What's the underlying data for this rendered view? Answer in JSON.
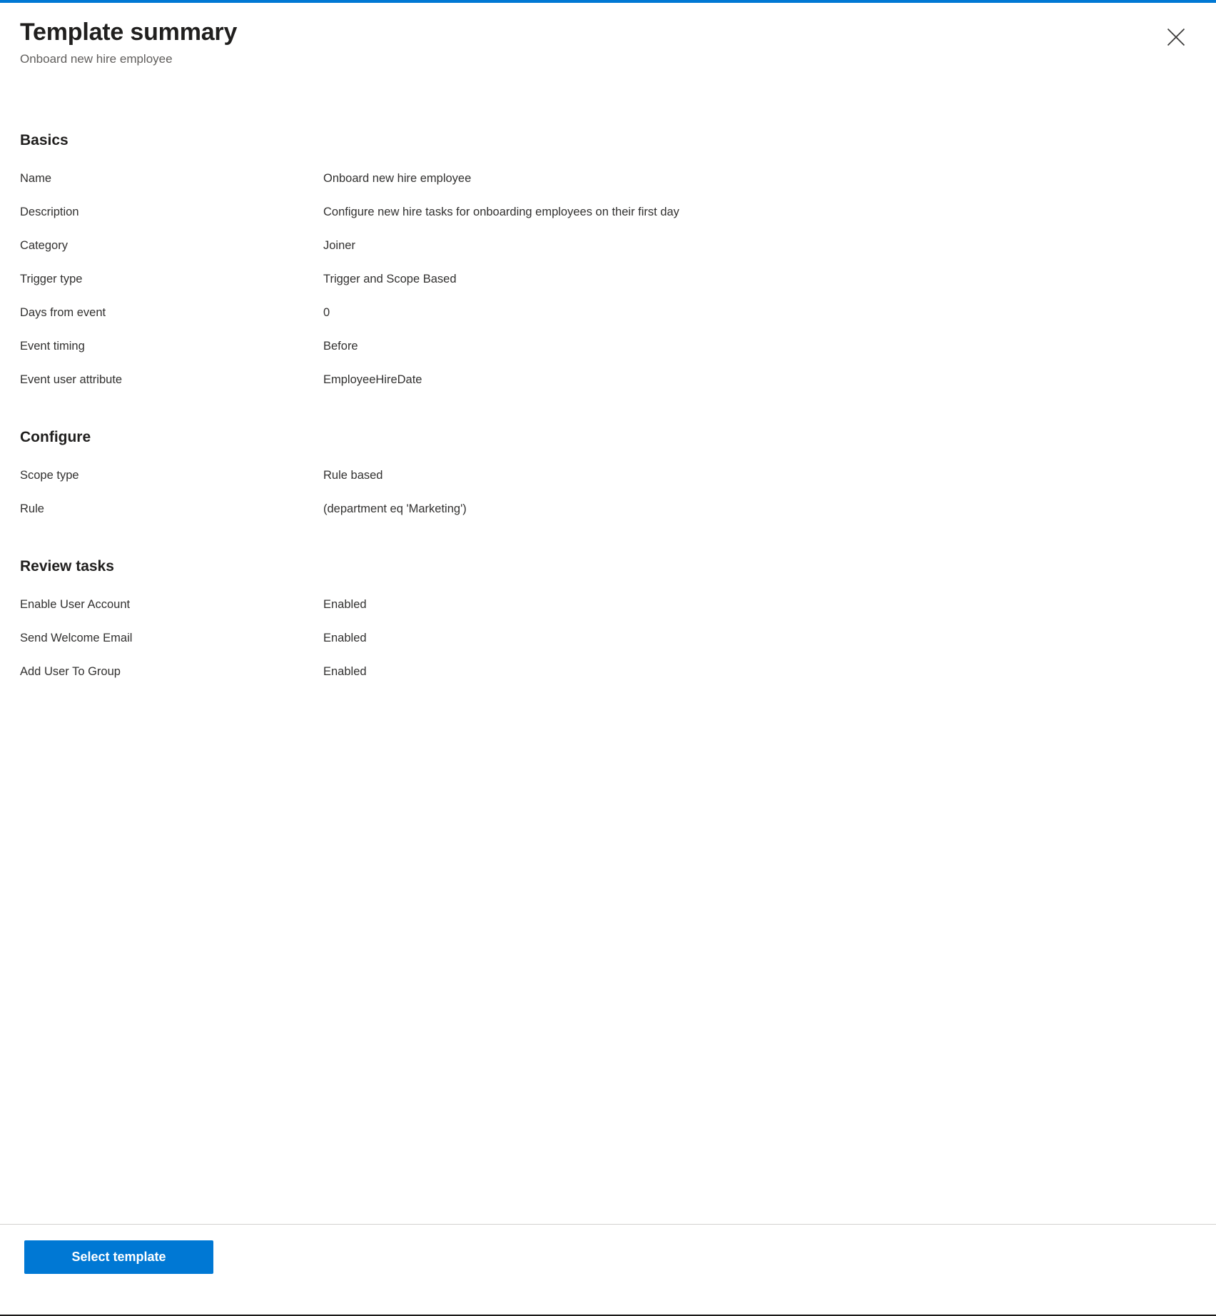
{
  "header": {
    "title": "Template summary",
    "subtitle": "Onboard new hire employee",
    "close_icon": "close-icon"
  },
  "colors": {
    "accent": "#0078d4",
    "top_bar": "#0078d4",
    "text": "#323130",
    "subtle_text": "#605e5c",
    "divider": "#d2d0ce"
  },
  "sections": [
    {
      "heading": "Basics",
      "rows": [
        {
          "label": "Name",
          "value": "Onboard new hire employee"
        },
        {
          "label": "Description",
          "value": "Configure new hire tasks for onboarding employees on their first day"
        },
        {
          "label": "Category",
          "value": "Joiner"
        },
        {
          "label": "Trigger type",
          "value": "Trigger and Scope Based"
        },
        {
          "label": "Days from event",
          "value": "0"
        },
        {
          "label": "Event timing",
          "value": "Before"
        },
        {
          "label": "Event user attribute",
          "value": "EmployeeHireDate"
        }
      ]
    },
    {
      "heading": "Configure",
      "rows": [
        {
          "label": "Scope type",
          "value": "Rule based"
        },
        {
          "label": "Rule",
          "value": "(department eq 'Marketing')"
        }
      ]
    },
    {
      "heading": "Review tasks",
      "rows": [
        {
          "label": "Enable User Account",
          "value": "Enabled"
        },
        {
          "label": "Send Welcome Email",
          "value": "Enabled"
        },
        {
          "label": "Add User To Group",
          "value": "Enabled"
        }
      ]
    }
  ],
  "footer": {
    "primary_button": "Select template"
  }
}
